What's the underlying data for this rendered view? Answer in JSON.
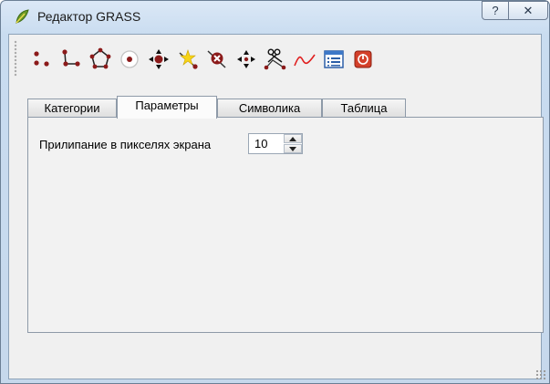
{
  "window": {
    "title": "Редактор GRASS",
    "help_label": "?",
    "close_label": "✕",
    "icon": "grass-leaf-icon"
  },
  "toolbar": {
    "tools": [
      {
        "name": "new-point-icon"
      },
      {
        "name": "new-line-icon"
      },
      {
        "name": "new-boundary-icon"
      },
      {
        "name": "new-centroid-icon"
      },
      {
        "name": "move-vertex-icon"
      },
      {
        "name": "add-vertex-icon"
      },
      {
        "name": "delete-vertex-icon"
      },
      {
        "name": "move-element-icon"
      },
      {
        "name": "split-line-icon"
      },
      {
        "name": "edit-line-icon"
      },
      {
        "name": "attributes-icon"
      },
      {
        "name": "close-editor-icon"
      }
    ]
  },
  "tabs": [
    {
      "label": "Категории",
      "active": false
    },
    {
      "label": "Параметры",
      "active": true
    },
    {
      "label": "Символика",
      "active": false
    },
    {
      "label": "Таблица",
      "active": false
    }
  ],
  "settings": {
    "snap_label": "Прилипание в пикселях экрана",
    "snap_value": "10"
  },
  "colors": {
    "accent": "#8b1a1a",
    "titlebar": "#c9dcf0"
  }
}
